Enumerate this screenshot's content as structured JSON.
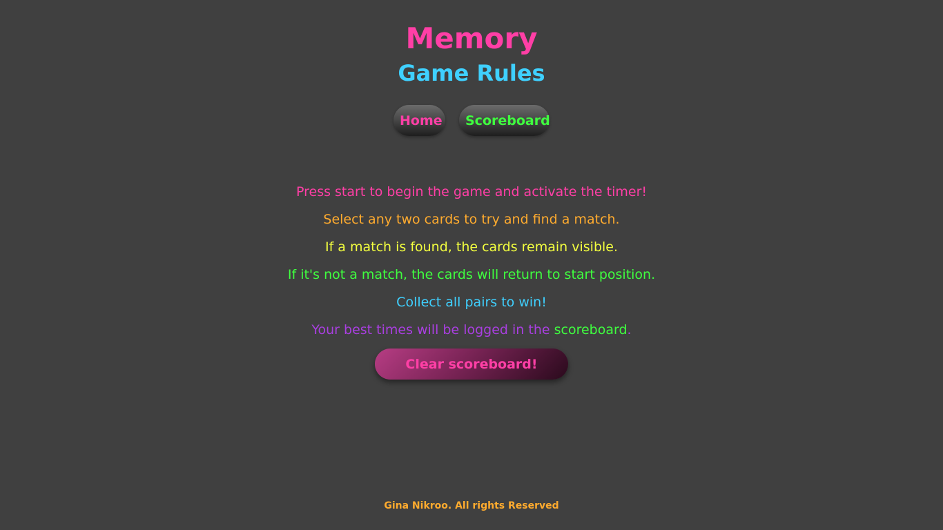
{
  "header": {
    "title": "Memory",
    "subtitle": "Game Rules"
  },
  "nav": {
    "home_label": "Home",
    "scoreboard_label": "Scoreboard"
  },
  "rules": {
    "items": [
      "Press start to begin the game and activate the timer!",
      "Select any two cards to try and find a match.",
      "If a match is found, the cards remain visible.",
      "If it's not a match, the cards will return to start position.",
      "Collect all pairs to win!"
    ],
    "last_prefix": "Your best times will be logged in the ",
    "last_link": "scoreboard",
    "last_suffix": "."
  },
  "actions": {
    "clear_label": "Clear scoreboard!"
  },
  "footer": {
    "text": "Gina Nikroo. All rights Reserved"
  },
  "colors": {
    "background": "#404040",
    "pink": "#ff3fa6",
    "cyan": "#3fd0ff",
    "green": "#3fff3f",
    "orange": "#ffab2e",
    "yellow": "#f3ff3f",
    "purple": "#a93fe0"
  }
}
